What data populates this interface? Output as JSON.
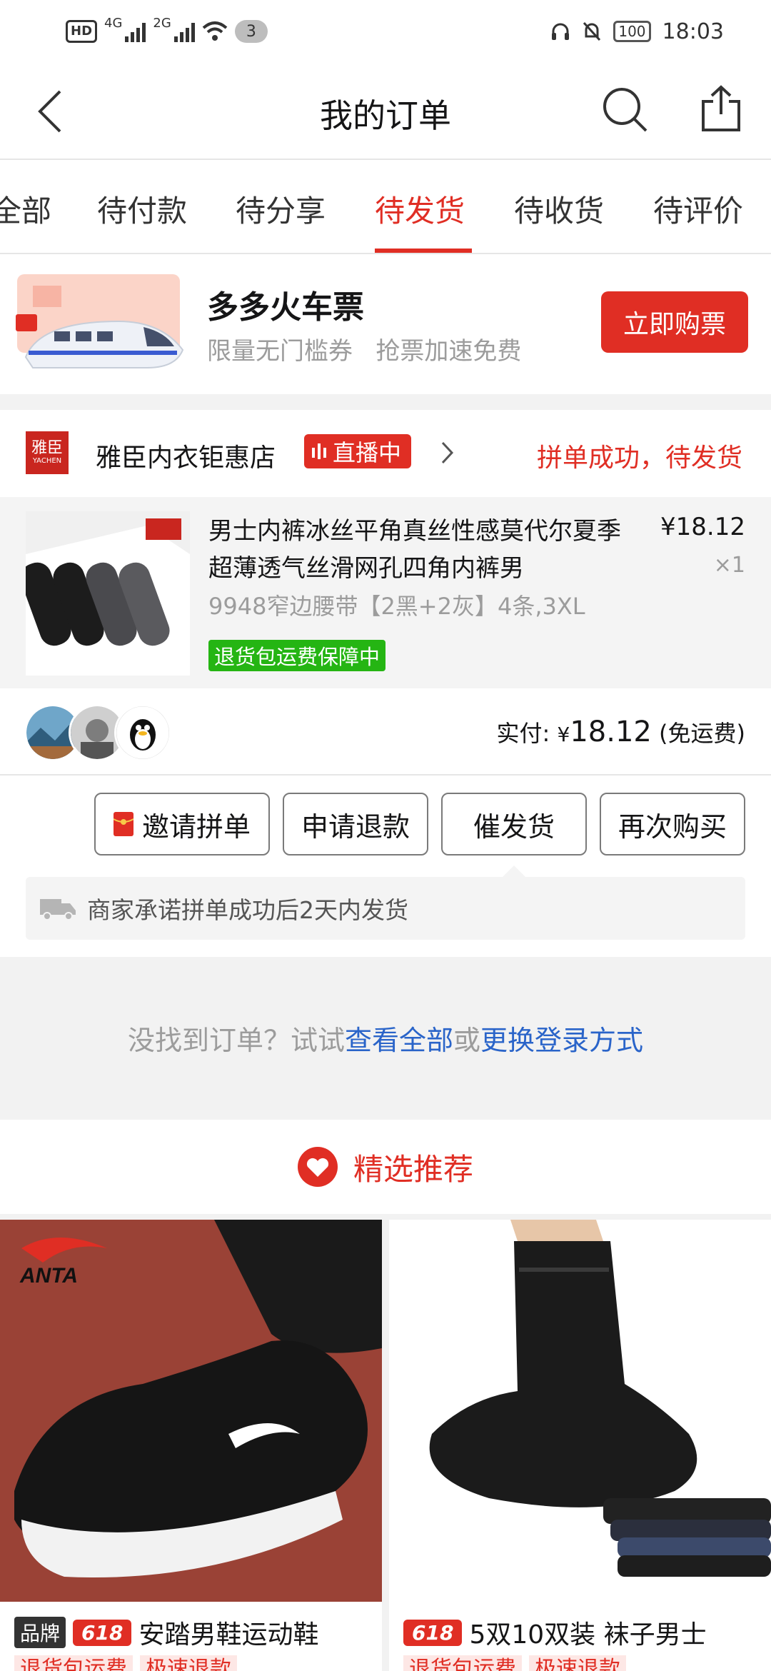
{
  "status_bar": {
    "hd": "HD",
    "net1": "4G",
    "net2": "2G",
    "notif_count": "3",
    "battery": "100",
    "time": "18:03"
  },
  "nav": {
    "title": "我的订单"
  },
  "tabs": [
    {
      "label": "全部"
    },
    {
      "label": "待付款"
    },
    {
      "label": "待分享"
    },
    {
      "label": "待发货"
    },
    {
      "label": "待收货"
    },
    {
      "label": "待评价"
    }
  ],
  "active_tab": "待发货",
  "promo": {
    "title": "多多火车票",
    "subtitle": "限量无门槛券   抢票加速免费",
    "button": "立即购票"
  },
  "order": {
    "shop_logo_cn": "雅臣",
    "shop_logo_en": "YACHEN",
    "shop_name": "雅臣内衣钜惠店",
    "live_label": "直播中",
    "status": "拼单成功，待发货",
    "item_name": "男士内裤冰丝平角真丝性感莫代尔夏季超薄透气丝滑网孔四角内裤男",
    "item_spec": "9948窄边腰带【2黑+2灰】4条,3XL",
    "return_tag": "退货包运费保障中",
    "price": "¥18.12",
    "qty": "×1",
    "paid_label": "实付: ",
    "paid_currency": "¥",
    "paid_amount": "18.12",
    "paid_note": " (免运费)",
    "buttons": {
      "invite": "邀请拼单",
      "refund": "申请退款",
      "urge": "催发货",
      "rebuy": "再次购买"
    },
    "notice": "商家承诺拼单成功后2天内发货"
  },
  "not_found": {
    "prefix": "没找到订单？试试",
    "link1": "查看全部",
    "mid": "或",
    "link2": "更换登录方式"
  },
  "recommend": {
    "title": "精选推荐"
  },
  "products": [
    {
      "brand_tag": "品牌",
      "promo_tag": "618",
      "title": "安踏男鞋运动鞋",
      "tags": [
        "退货包运费",
        "极速退款"
      ]
    },
    {
      "promo_tag": "618",
      "title": "5双10双装 袜子男士",
      "tags": [
        "退货包运费",
        "极速退款"
      ]
    }
  ],
  "colors": {
    "accent": "#e02e24",
    "link": "#2a64c9",
    "green_tag": "#25b513"
  }
}
